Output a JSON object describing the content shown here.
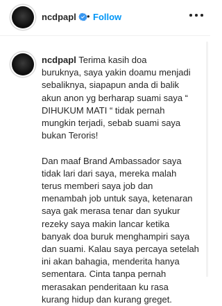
{
  "header": {
    "username": "ncdpapl",
    "separator": "•",
    "follow_label": "Follow"
  },
  "post": {
    "username": "ncdpapl",
    "caption_lines": [
      " Terima kasih doa",
      "buruknya, saya yakin doamu menjadi",
      "sebaliknya, siapapun anda di balik",
      "akun anon yg berharap suami saya “",
      "DIHUKUM MATI “ tidak pernah",
      "mungkin terjadi, sebab suami saya",
      "bukan Teroris!",
      "",
      "Dan maaf Brand Ambassador saya",
      "tidak lari dari saya, mereka malah",
      "terus memberi saya job dan",
      "menambah job untuk saya, ketenaran",
      "saya gak merasa tenar dan syukur",
      "rezeky saya makin lancar ketika",
      "banyak doa buruk menghampiri saya",
      "dan suami. Kalau saya percaya setelah",
      "ini akan bahagia, menderita hanya",
      "sementara. Cinta tanpa pernah",
      "merasakan penderitaan ku rasa",
      "kurang hidup dan kurang greget."
    ]
  },
  "colors": {
    "accent": "#0095f6",
    "verified": "#3897f0",
    "text": "#262626"
  }
}
